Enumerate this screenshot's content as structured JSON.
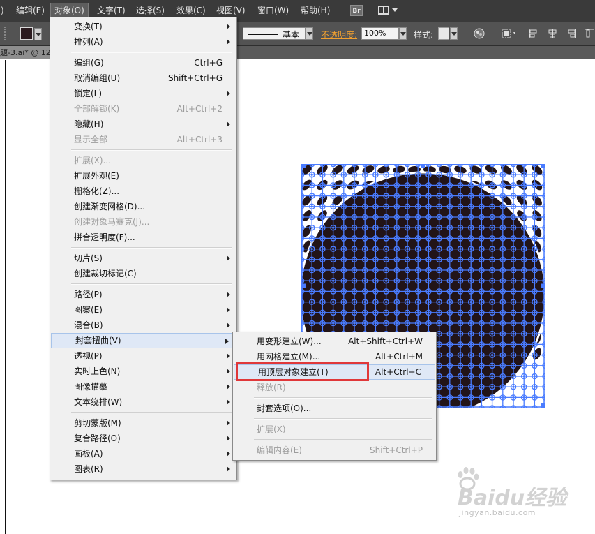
{
  "menubar": {
    "items": [
      {
        "label": ")"
      },
      {
        "label": "编辑(E)"
      },
      {
        "label": "对象(O)"
      },
      {
        "label": "文字(T)"
      },
      {
        "label": "选择(S)"
      },
      {
        "label": "效果(C)"
      },
      {
        "label": "视图(V)"
      },
      {
        "label": "窗口(W)"
      },
      {
        "label": "帮助(H)"
      }
    ],
    "bridge_label": "Br"
  },
  "control": {
    "stroke_style_label": "基本",
    "opacity_label": "不透明度",
    "opacity_colon": ":",
    "opacity_value": "100%",
    "style_label": "样式:",
    "fill_color": "#2b1b1f"
  },
  "document": {
    "tab_label": "题-3.ai* @ 12"
  },
  "object_menu": {
    "items": [
      {
        "label": "变换(T)",
        "shortcut": "",
        "submenu": true,
        "disabled": false
      },
      {
        "label": "排列(A)",
        "shortcut": "",
        "submenu": true,
        "disabled": false
      },
      {
        "label": "编组(G)",
        "shortcut": "Ctrl+G",
        "submenu": false,
        "disabled": false
      },
      {
        "label": "取消编组(U)",
        "shortcut": "Shift+Ctrl+G",
        "submenu": false,
        "disabled": false
      },
      {
        "label": "锁定(L)",
        "shortcut": "",
        "submenu": true,
        "disabled": false
      },
      {
        "label": "全部解锁(K)",
        "shortcut": "Alt+Ctrl+2",
        "submenu": false,
        "disabled": true
      },
      {
        "label": "隐藏(H)",
        "shortcut": "",
        "submenu": true,
        "disabled": false
      },
      {
        "label": "显示全部",
        "shortcut": "Alt+Ctrl+3",
        "submenu": false,
        "disabled": true
      },
      {
        "label": "扩展(X)...",
        "shortcut": "",
        "submenu": false,
        "disabled": true
      },
      {
        "label": "扩展外观(E)",
        "shortcut": "",
        "submenu": false,
        "disabled": false
      },
      {
        "label": "栅格化(Z)...",
        "shortcut": "",
        "submenu": false,
        "disabled": false
      },
      {
        "label": "创建渐变网格(D)...",
        "shortcut": "",
        "submenu": false,
        "disabled": false
      },
      {
        "label": "创建对象马赛克(J)...",
        "shortcut": "",
        "submenu": false,
        "disabled": true
      },
      {
        "label": "拼合透明度(F)...",
        "shortcut": "",
        "submenu": false,
        "disabled": false
      },
      {
        "label": "切片(S)",
        "shortcut": "",
        "submenu": true,
        "disabled": false
      },
      {
        "label": "创建裁切标记(C)",
        "shortcut": "",
        "submenu": false,
        "disabled": false
      },
      {
        "label": "路径(P)",
        "shortcut": "",
        "submenu": true,
        "disabled": false
      },
      {
        "label": "图案(E)",
        "shortcut": "",
        "submenu": true,
        "disabled": false
      },
      {
        "label": "混合(B)",
        "shortcut": "",
        "submenu": true,
        "disabled": false
      },
      {
        "label": "封套扭曲(V)",
        "shortcut": "",
        "submenu": true,
        "disabled": false
      },
      {
        "label": "透视(P)",
        "shortcut": "",
        "submenu": true,
        "disabled": false
      },
      {
        "label": "实时上色(N)",
        "shortcut": "",
        "submenu": true,
        "disabled": false
      },
      {
        "label": "图像描摹",
        "shortcut": "",
        "submenu": true,
        "disabled": false
      },
      {
        "label": "文本绕排(W)",
        "shortcut": "",
        "submenu": true,
        "disabled": false
      },
      {
        "label": "剪切蒙版(M)",
        "shortcut": "",
        "submenu": true,
        "disabled": false
      },
      {
        "label": "复合路径(O)",
        "shortcut": "",
        "submenu": true,
        "disabled": false
      },
      {
        "label": "画板(A)",
        "shortcut": "",
        "submenu": true,
        "disabled": false
      },
      {
        "label": "图表(R)",
        "shortcut": "",
        "submenu": true,
        "disabled": false
      }
    ]
  },
  "envelope_submenu": {
    "items": [
      {
        "label": "用变形建立(W)...",
        "shortcut": "Alt+Shift+Ctrl+W",
        "disabled": false
      },
      {
        "label": "用网格建立(M)...",
        "shortcut": "Alt+Ctrl+M",
        "disabled": false
      },
      {
        "label": "用顶层对象建立(T)",
        "shortcut": "Alt+Ctrl+C",
        "disabled": false
      },
      {
        "label": "释放(R)",
        "shortcut": "",
        "disabled": true
      },
      {
        "label": "封套选项(O)...",
        "shortcut": "",
        "disabled": false
      },
      {
        "label": "扩展(X)",
        "shortcut": "",
        "disabled": true
      },
      {
        "label": "编辑内容(E)",
        "shortcut": "Shift+Ctrl+P",
        "disabled": true
      }
    ]
  },
  "artwork": {
    "fill": "#221418",
    "selection_color": "#4a7cff"
  },
  "watermark": {
    "brand": "Baidu经验",
    "url": "jingyan.baidu.com"
  }
}
